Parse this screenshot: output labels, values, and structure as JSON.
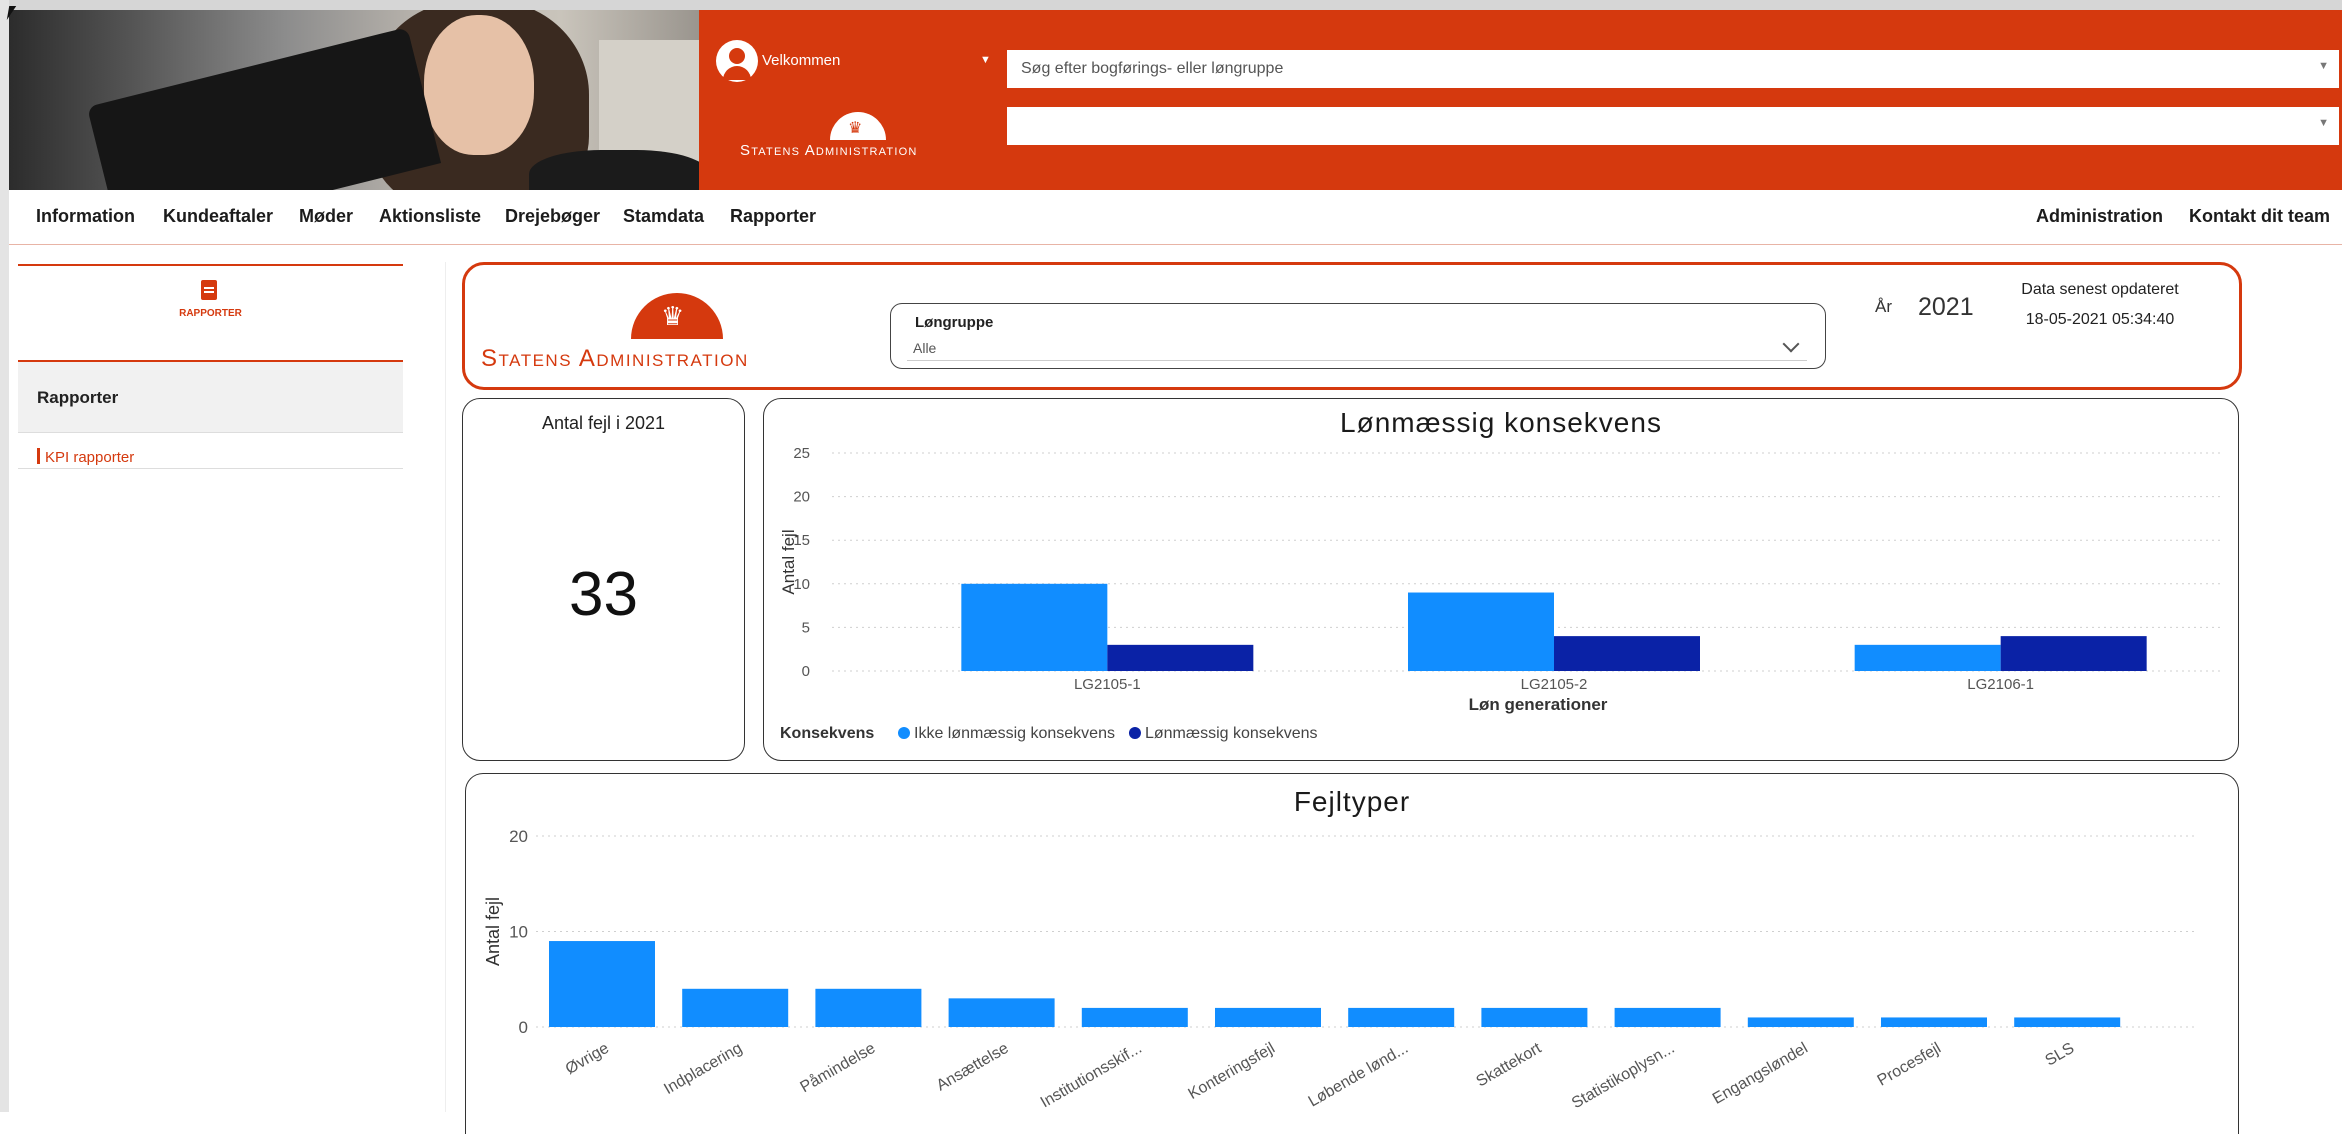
{
  "header": {
    "welcome": "Velkommen",
    "search_placeholder": "Søg efter bogførings- eller løngruppe",
    "second_select_value": "",
    "logo_text": "Statens Administration"
  },
  "nav": {
    "left": [
      "Information",
      "Kundeaftaler",
      "Møder",
      "Aktionsliste",
      "Drejebøger",
      "Stamdata",
      "Rapporter"
    ],
    "right": [
      "Administration",
      "Kontakt dit team"
    ]
  },
  "sidebar": {
    "card_caption": "RAPPORTER",
    "section_title": "Rapporter",
    "links": [
      "KPI rapporter"
    ]
  },
  "report": {
    "logo_text": "Statens Administration",
    "slicer_label": "Løngruppe",
    "slicer_value": "Alle",
    "year_label": "År",
    "year_value": "2021",
    "updated_label": "Data senest opdateret",
    "updated_value": "18-05-2021 05:34:40"
  },
  "kpi": {
    "title": "Antal fejl i 2021",
    "value": "33"
  },
  "colors": {
    "accent": "#d5390e",
    "series_light": "#118dff",
    "series_dark": "#0a22a6"
  },
  "chart_data": [
    {
      "type": "bar",
      "title": "Lønmæssig konsekvens",
      "xlabel": "Løn generationer",
      "ylabel": "Antal fejl",
      "categories": [
        "LG2105-1",
        "LG2105-2",
        "LG2106-1"
      ],
      "series": [
        {
          "name": "Ikke lønmæssig konsekvens",
          "values": [
            10,
            9,
            3
          ],
          "color": "#118dff"
        },
        {
          "name": "Lønmæssig konsekvens",
          "values": [
            3,
            4,
            4
          ],
          "color": "#0a22a6"
        }
      ],
      "ylim": [
        0,
        25
      ],
      "yticks": [
        0,
        5,
        10,
        15,
        20,
        25
      ],
      "grid": true,
      "legend_title": "Konsekvens",
      "legend_position": "bottom-left"
    },
    {
      "type": "bar",
      "title": "Fejltyper",
      "ylabel": "Antal fejl",
      "categories": [
        "Øvrige",
        "Indplacering",
        "Påmindelse",
        "Ansættelse",
        "Institutionsskif...",
        "Konteringsfejl",
        "Løbende lønd...",
        "Skattekort",
        "Statistikoplysn...",
        "Engangsløndel",
        "Procesfejl",
        "SLS"
      ],
      "values": [
        9,
        4,
        4,
        3,
        2,
        2,
        2,
        2,
        2,
        1,
        1,
        1
      ],
      "color": "#118dff",
      "ylim": [
        0,
        20
      ],
      "yticks": [
        0,
        10,
        20
      ],
      "grid": true
    }
  ]
}
